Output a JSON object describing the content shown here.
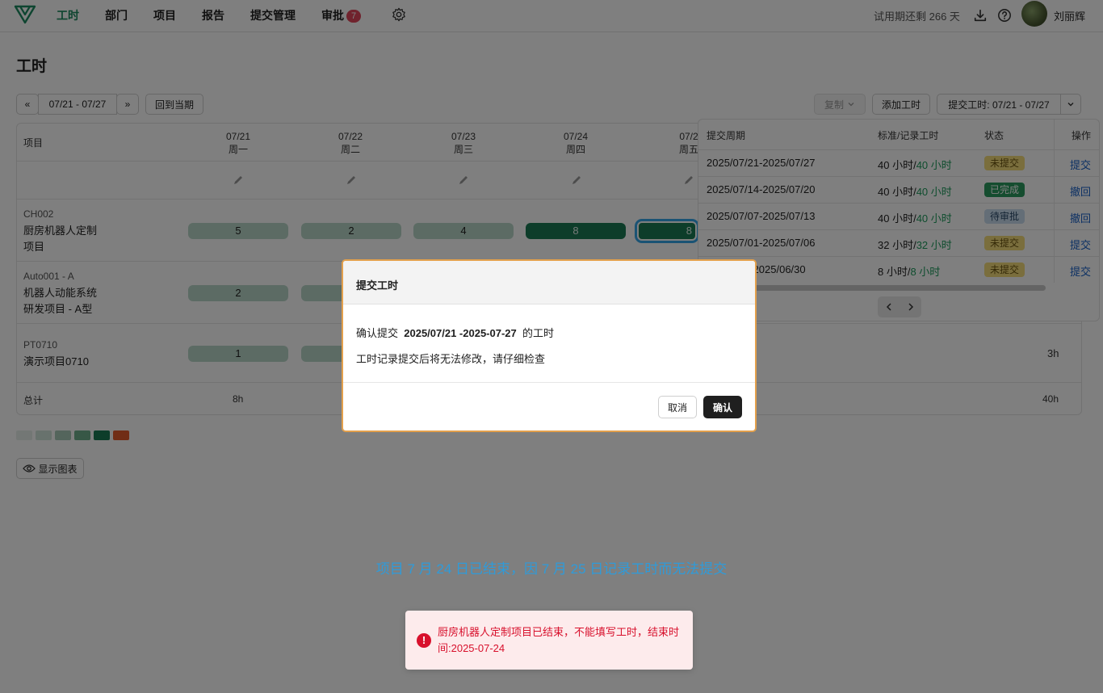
{
  "nav": {
    "items": [
      "工时",
      "部门",
      "项目",
      "报告",
      "提交管理",
      "审批"
    ],
    "approval_badge": "7",
    "trial_text": "试用期还剩 266 天",
    "username": "刘丽辉"
  },
  "page": {
    "title": "工时"
  },
  "toolbar": {
    "prev": "«",
    "week_range": "07/21 - 07/27",
    "next": "»",
    "current_period": "回到当期",
    "copy": "复制",
    "add_hours": "添加工时",
    "submit_hours": "提交工时: 07/21 - 07/27"
  },
  "grid": {
    "header_project": "项目",
    "days": [
      {
        "date": "07/21",
        "weekday": "周一"
      },
      {
        "date": "07/22",
        "weekday": "周二"
      },
      {
        "date": "07/23",
        "weekday": "周三"
      },
      {
        "date": "07/24",
        "weekday": "周四"
      },
      {
        "date": "07/2",
        "weekday": "周五"
      }
    ],
    "rows": [
      {
        "code": "CH002",
        "name1": "厨房机器人定制",
        "name2": "项目",
        "cells": [
          "5",
          "2",
          "4",
          "8",
          "8"
        ]
      },
      {
        "code": "Auto001 - A",
        "name1": "机器人动能系统",
        "name2": "研发项目 - A型",
        "cells": [
          "2"
        ]
      },
      {
        "code": "PT0710",
        "name1": "演示项目0710",
        "cells": [
          "1"
        ],
        "row_total": "3h"
      }
    ],
    "total_label": "总计",
    "total_mon": "8h",
    "total_week": "40h"
  },
  "legend_colors": [
    "#e6efea",
    "#d0e4da",
    "#a8cbb8",
    "#6fae8d",
    "#1a7a55",
    "#e25a2c"
  ],
  "show_chart": "显示图表",
  "submission_panel": {
    "headers": [
      "提交周期",
      "标准/记录工时",
      "状态",
      "操作"
    ],
    "rows": [
      {
        "period": "2025/07/21-2025/07/27",
        "std": "40 小时/",
        "rec": "40 小时",
        "status": "未提交",
        "action": "提交"
      },
      {
        "period": "2025/07/14-2025/07/20",
        "std": "40 小时/",
        "rec": "40 小时",
        "status": "已完成",
        "action": "撤回"
      },
      {
        "period": "2025/07/07-2025/07/13",
        "std": "40 小时/",
        "rec": "40 小时",
        "status": "待审批",
        "action": "撤回"
      },
      {
        "period": "2025/07/01-2025/07/06",
        "std": "32 小时/",
        "rec": "32 小时",
        "status": "未提交",
        "action": "提交"
      },
      {
        "period": "0-2025/06/30",
        "std": "8 小时/",
        "rec": "8 小时",
        "status": "未提交",
        "action": "提交"
      }
    ]
  },
  "modal": {
    "title": "提交工时",
    "line1_prefix": "确认提交",
    "line1_range": "2025/07/21 -2025-07-27",
    "line1_suffix": "的工时",
    "line2": "工时记录提交后将无法修改，请仔细检查",
    "cancel": "取消",
    "confirm": "确认"
  },
  "hint": "项目 7 月 24 日已结束，因 7 月 25 日记录工时而无法提交",
  "toast": {
    "text": "厨房机器人定制项目已结束，不能填写工时，结束时间:2025-07-24"
  }
}
